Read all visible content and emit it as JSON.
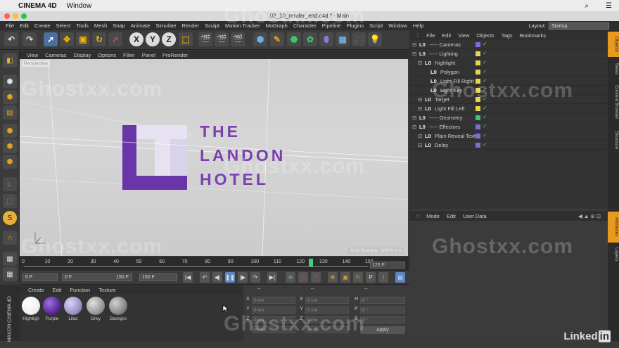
{
  "mac_menubar": {
    "app_name": "CINEMA 4D",
    "window_menu": "Window"
  },
  "window": {
    "title": "02_10_render_end.c4d * - Main"
  },
  "app_menu": {
    "items": [
      "File",
      "Edit",
      "Create",
      "Select",
      "Tools",
      "Mesh",
      "Snap",
      "Animate",
      "Simulate",
      "Render",
      "Sculpt",
      "Motion Tracker",
      "MoGraph",
      "Character",
      "Pipeline",
      "Plugins",
      "Script",
      "Window",
      "Help"
    ],
    "layout_label": "Layout:",
    "layout_value": "Startup"
  },
  "toolbar": {
    "axis_x": "X",
    "axis_y": "Y",
    "axis_z": "Z"
  },
  "viewport": {
    "menu": [
      "View",
      "Cameras",
      "Display",
      "Options",
      "Filter",
      "Panel",
      "ProRender"
    ],
    "camera_label": "Perspective",
    "grid_spacing": "Grid Spacing : 10000 cm",
    "logo_lines": [
      "THE",
      "LANDON",
      "HOTEL"
    ],
    "logo_color": "#7a3fb0"
  },
  "timeline": {
    "ticks": [
      "0",
      "10",
      "20",
      "30",
      "40",
      "50",
      "60",
      "70",
      "80",
      "90",
      "100",
      "110",
      "120",
      "130",
      "140",
      "150"
    ],
    "current_frame": "125 F",
    "playhead_fraction": 0.83
  },
  "transport": {
    "start": "0 F",
    "min": "0 F",
    "max": "150 F",
    "end": "150 F"
  },
  "material_manager": {
    "menu": [
      "Create",
      "Edit",
      "Function",
      "Texture"
    ],
    "materials": [
      {
        "name": "Highligh",
        "color": "#f2f2f2"
      },
      {
        "name": "Purple",
        "color": "#5a2a9a"
      },
      {
        "name": "Lilac",
        "color": "#9a94c8"
      },
      {
        "name": "Grey",
        "color": "#9a9a9a"
      },
      {
        "name": "Backgro",
        "color": "#8a8a8a"
      }
    ]
  },
  "coordinates": {
    "headers": [
      "--",
      "--",
      "--"
    ],
    "rows": [
      {
        "a": "X",
        "av": "0 cm",
        "b": "X",
        "bv": "0 cm",
        "c": "H",
        "cv": "0 °"
      },
      {
        "a": "Y",
        "av": "0 cm",
        "b": "Y",
        "bv": "0 cm",
        "c": "P",
        "cv": "0 °"
      },
      {
        "a": "Z",
        "av": "0 cm",
        "b": "Z",
        "bv": "0 cm",
        "c": "B",
        "cv": "0 °"
      }
    ],
    "mode1": "World",
    "mode2": "Scale",
    "apply": "Apply"
  },
  "branding": {
    "maxon": "MAXON CINEMA 4D",
    "linkedin": "Linked"
  },
  "objects_panel": {
    "menu": [
      "File",
      "Edit",
      "View",
      "Objects",
      "Tags",
      "Bookmarks"
    ],
    "rows": [
      {
        "name": "----- Cameras",
        "indent": 0,
        "color": "#7c6fd6"
      },
      {
        "name": "----- Lighting",
        "indent": 0,
        "color": "#e8d44d"
      },
      {
        "name": "Highlight",
        "indent": 1,
        "color": "#e8d44d"
      },
      {
        "name": "Polygon",
        "indent": 2,
        "color": "#e8d44d"
      },
      {
        "name": "Light Fill Right",
        "indent": 2,
        "color": "#e8d44d"
      },
      {
        "name": "Light Key",
        "indent": 2,
        "color": "#e8d44d"
      },
      {
        "name": "Target",
        "indent": 1,
        "color": "#e8d44d"
      },
      {
        "name": "Light Fill Left",
        "indent": 1,
        "color": "#e8d44d"
      },
      {
        "name": "----- Geometry",
        "indent": 0,
        "color": "#3ec46d"
      },
      {
        "name": "----- Effectors",
        "indent": 0,
        "color": "#7c6fd6"
      },
      {
        "name": "Plain Reveal Text",
        "indent": 1,
        "color": "#7c6fd6"
      },
      {
        "name": "Delay",
        "indent": 1,
        "color": "#7c6fd6"
      }
    ]
  },
  "attributes_panel": {
    "menu": [
      "Mode",
      "Edit",
      "User Data"
    ]
  },
  "right_tabs": [
    "Objects",
    "Takes",
    "Content Browser",
    "Structure",
    "Attributes",
    "Layers"
  ],
  "watermark": "Ghostxx.com"
}
